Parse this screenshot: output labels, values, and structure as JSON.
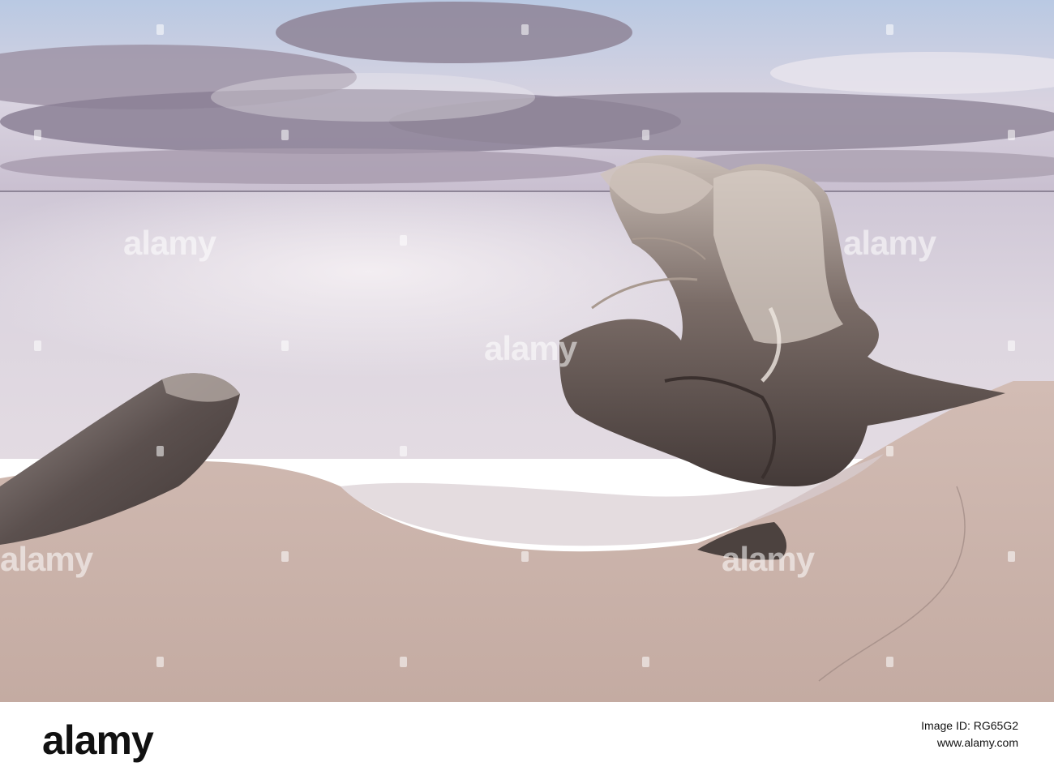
{
  "image": {
    "description_colors": {
      "sky_top": "#c8d4e6",
      "cloud": "#8f8499",
      "sea": "#d8d2de",
      "sand": "#c7afa7",
      "driftwood": "#5a4f4c"
    }
  },
  "watermark": {
    "text": "alamy"
  },
  "footer": {
    "logo": "alamy",
    "id_label": "Image ID: ",
    "id_value": "RG65G2",
    "url": "www.alamy.com"
  }
}
